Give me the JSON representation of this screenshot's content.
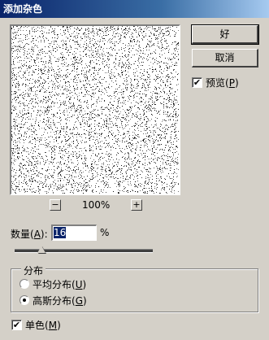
{
  "dialog": {
    "title": "添加杂色"
  },
  "buttons": {
    "ok_label": "好",
    "cancel_label": "取消"
  },
  "preview": {
    "label": "预览",
    "hotkey": "P",
    "checked": true,
    "check_mark": "✔"
  },
  "zoom": {
    "minus": "−",
    "plus": "+",
    "value": "100%"
  },
  "amount": {
    "label": "数量",
    "hotkey": "A",
    "value": "16",
    "unit": "%",
    "slider_fraction": 0.16
  },
  "distribution": {
    "title": "分布",
    "uniform": {
      "label": "平均分布",
      "hotkey": "U",
      "checked": false
    },
    "gaussian": {
      "label": "高斯分布",
      "hotkey": "G",
      "checked": true
    }
  },
  "monochromatic": {
    "label": "单色",
    "hotkey": "M",
    "checked": true,
    "check_mark": "✔"
  },
  "colors": {
    "title_bar": "#0a246a",
    "face": "#d4d0c8",
    "selection": "#0a246a"
  }
}
